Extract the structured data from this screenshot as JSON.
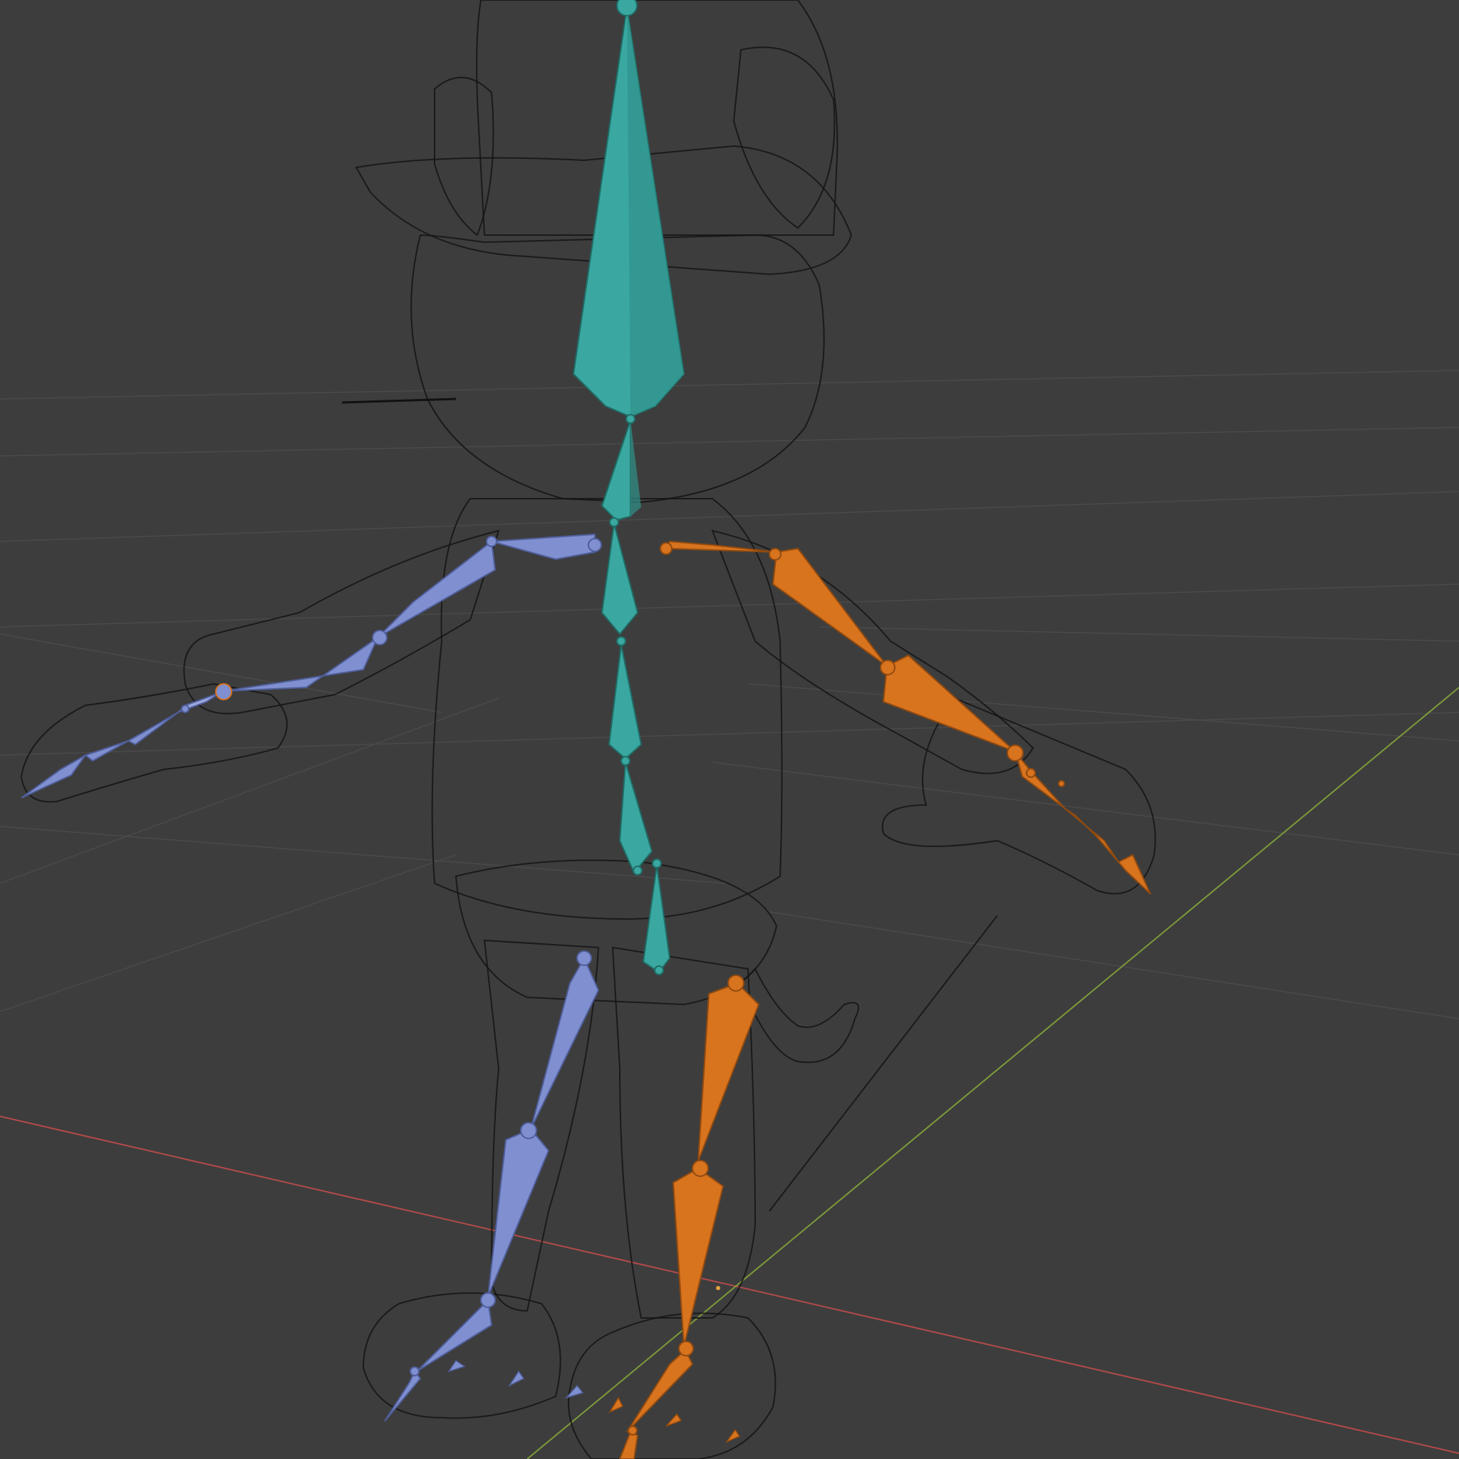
{
  "viewport": {
    "background": "#3d3d3d",
    "grid_color": "#4a4a4a",
    "x_axis_color": "#b34a4a",
    "y_axis_color": "#7d9a3a",
    "wireframe_color": "#141414"
  },
  "armature": {
    "colors": {
      "spine": "#3aa8a0",
      "left_side": "#7f8fcf",
      "right_side": "#d8731e"
    },
    "bone_groups": [
      "spine",
      "left-arm",
      "right-arm",
      "left-leg",
      "right-leg"
    ]
  },
  "icons": {
    "wireframe": "character-wireframe-icon",
    "origin": "object-origin-icon"
  }
}
